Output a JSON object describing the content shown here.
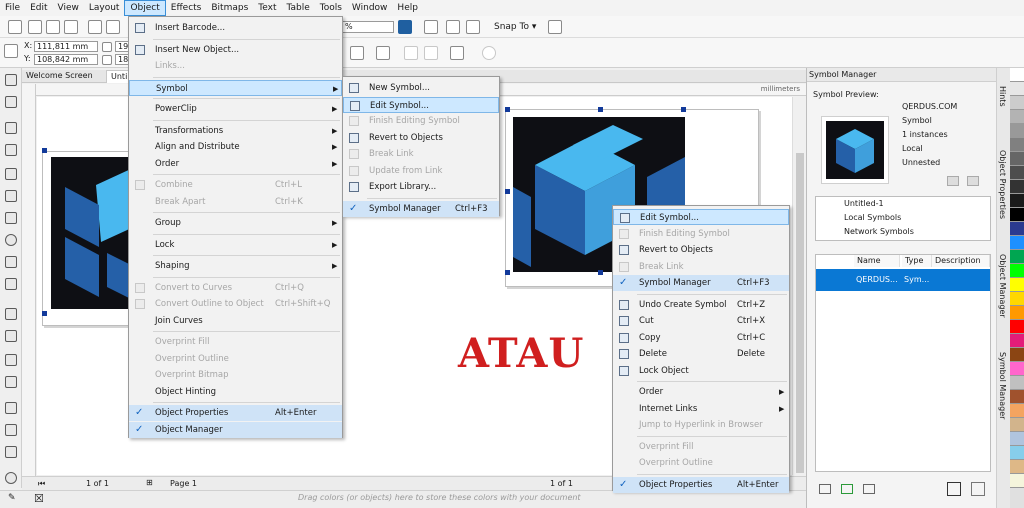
{
  "menubar": [
    "File",
    "Edit",
    "View",
    "Layout",
    "Object",
    "Effects",
    "Bitmaps",
    "Text",
    "Table",
    "Tools",
    "Window",
    "Help"
  ],
  "toolbar": {
    "zoom_suffix": "%",
    "snap_to": "Snap To",
    "x_label": "X:",
    "x_value": "111,811 mm",
    "y_label": "Y:",
    "y_value": "108,842 mm",
    "w_value_partial": "19",
    "h_value_partial": "18"
  },
  "tabs": [
    "Welcome Screen",
    "Unti"
  ],
  "ruler_unit": "millimeters",
  "status": {
    "page_left": "1 of 1",
    "page_name": "Page 1",
    "page_right": "1 of 1",
    "drag_hint": "Drag colors (or objects) here to store these colors with your document"
  },
  "canvas_text": "ATAU",
  "object_menu": [
    {
      "label": "Insert Barcode...",
      "icon": "barcode-icon"
    },
    {
      "sep": true
    },
    {
      "label": "Insert New Object...",
      "icon": "insert-object-icon"
    },
    {
      "label": "Links...",
      "disabled": true
    },
    {
      "sep": true
    },
    {
      "label": "Symbol",
      "submenu": true,
      "highlight": true
    },
    {
      "sep": true
    },
    {
      "label": "PowerClip",
      "submenu": true
    },
    {
      "sep": true
    },
    {
      "label": "Transformations",
      "submenu": true
    },
    {
      "label": "Align and Distribute",
      "submenu": true
    },
    {
      "label": "Order",
      "submenu": true
    },
    {
      "sep": true
    },
    {
      "label": "Combine",
      "shortcut": "Ctrl+L",
      "disabled": true,
      "icon": "combine-icon"
    },
    {
      "label": "Break Apart",
      "shortcut": "Ctrl+K",
      "disabled": true
    },
    {
      "sep": true
    },
    {
      "label": "Group",
      "submenu": true
    },
    {
      "sep": true
    },
    {
      "label": "Lock",
      "submenu": true
    },
    {
      "sep": true
    },
    {
      "label": "Shaping",
      "submenu": true
    },
    {
      "sep": true
    },
    {
      "label": "Convert to Curves",
      "shortcut": "Ctrl+Q",
      "disabled": true,
      "icon": "convert-curves-icon"
    },
    {
      "label": "Convert Outline to Object",
      "shortcut": "Ctrl+Shift+Q",
      "disabled": true,
      "icon": "convert-outline-icon"
    },
    {
      "label": "Join Curves"
    },
    {
      "sep": true
    },
    {
      "label": "Overprint Fill",
      "disabled": true
    },
    {
      "label": "Overprint Outline",
      "disabled": true
    },
    {
      "label": "Overprint Bitmap",
      "disabled": true
    },
    {
      "label": "Object Hinting"
    },
    {
      "sep": true
    },
    {
      "label": "Object Properties",
      "shortcut": "Alt+Enter",
      "checked": true
    },
    {
      "label": "Object Manager",
      "checked": true
    }
  ],
  "symbol_submenu": [
    {
      "label": "New Symbol...",
      "icon": "new-symbol-icon"
    },
    {
      "label": "Edit Symbol...",
      "icon": "edit-symbol-icon",
      "highlight": true
    },
    {
      "label": "Finish Editing Symbol",
      "disabled": true,
      "icon": "finish-symbol-icon"
    },
    {
      "label": "Revert to Objects",
      "icon": "revert-objects-icon"
    },
    {
      "label": "Break Link",
      "disabled": true,
      "icon": "break-link-icon"
    },
    {
      "label": "Update from Link",
      "disabled": true,
      "icon": "update-link-icon"
    },
    {
      "label": "Export Library...",
      "icon": "export-library-icon"
    },
    {
      "sep": true
    },
    {
      "label": "Symbol Manager",
      "shortcut": "Ctrl+F3",
      "checked": true
    }
  ],
  "context_menu": [
    {
      "label": "Edit Symbol...",
      "icon": "edit-symbol-icon",
      "highlight": true
    },
    {
      "label": "Finish Editing Symbol",
      "disabled": true,
      "icon": "finish-symbol-icon"
    },
    {
      "label": "Revert to Objects",
      "icon": "revert-objects-icon"
    },
    {
      "label": "Break Link",
      "disabled": true,
      "icon": "break-link-icon"
    },
    {
      "label": "Symbol Manager",
      "shortcut": "Ctrl+F3",
      "checked": true
    },
    {
      "sep": true
    },
    {
      "label": "Undo Create Symbol",
      "shortcut": "Ctrl+Z",
      "icon": "undo-icon"
    },
    {
      "label": "Cut",
      "shortcut": "Ctrl+X",
      "icon": "cut-icon"
    },
    {
      "label": "Copy",
      "shortcut": "Ctrl+C",
      "icon": "copy-icon"
    },
    {
      "label": "Delete",
      "shortcut": "Delete",
      "icon": "delete-icon"
    },
    {
      "label": "Lock Object",
      "icon": "lock-icon"
    },
    {
      "sep": true
    },
    {
      "label": "Order",
      "submenu": true
    },
    {
      "label": "Internet Links",
      "submenu": true
    },
    {
      "label": "Jump to Hyperlink in Browser",
      "disabled": true
    },
    {
      "sep": true
    },
    {
      "label": "Overprint Fill",
      "disabled": true
    },
    {
      "label": "Overprint Outline",
      "disabled": true
    },
    {
      "sep": true
    },
    {
      "label": "Object Properties",
      "shortcut": "Alt+Enter",
      "checked": true
    }
  ],
  "docker": {
    "title": "Symbol Manager",
    "preview_label": "Symbol Preview:",
    "info": [
      "QERDUS.COM",
      "Symbol",
      "1 instances",
      "Local",
      "Unnested"
    ],
    "tree": [
      "Untitled-1",
      "Local Symbols",
      "Network Symbols"
    ],
    "columns": [
      "Name",
      "Type",
      "Description"
    ],
    "row": {
      "name": "QERDUS...",
      "type": "Sym..."
    }
  },
  "vertical_tabs": [
    "Hints",
    "Object Properties",
    "Object Manager",
    "Symbol Manager"
  ],
  "palette": [
    "#ffffff",
    "#e6e6e6",
    "#cccccc",
    "#b3b3b3",
    "#999999",
    "#808080",
    "#666666",
    "#4d4d4d",
    "#333333",
    "#1a1a1a",
    "#000000",
    "#2b3a8f",
    "#1e90ff",
    "#00a651",
    "#00ff00",
    "#ffff00",
    "#ffd700",
    "#ff9900",
    "#ff0000",
    "#e31c79",
    "#8b4513",
    "#ff66cc",
    "#c0c0c0",
    "#a0522d",
    "#f4a460",
    "#d2b48c",
    "#b0c4de",
    "#87ceeb",
    "#deb887",
    "#f5f5dc"
  ],
  "colors": {
    "logo_bg": "#0e0f14",
    "logo_light": "#49b8ef",
    "logo_dark": "#2560a8",
    "menu_highlight": "#cde8ff",
    "selection": "#0a78d4",
    "atau": "#d01f1f"
  }
}
